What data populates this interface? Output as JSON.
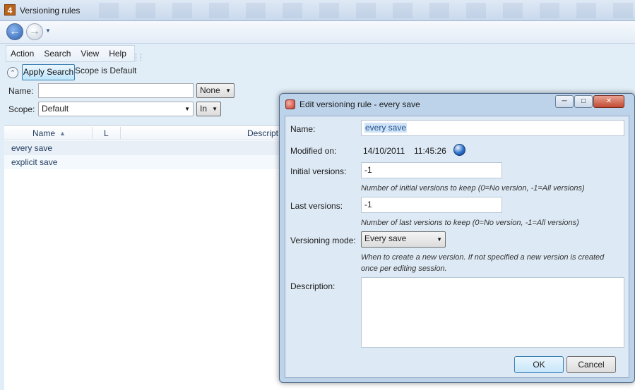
{
  "window": {
    "title": "Versioning rules",
    "app_icon_text": "4"
  },
  "menu": {
    "items": [
      "Action",
      "Search",
      "View",
      "Help"
    ]
  },
  "search": {
    "apply_label": "Apply Search",
    "scope_note": "Scope is Default",
    "name_label": "Name:",
    "name_value": "",
    "name_match": "None",
    "scope_label": "Scope:",
    "scope_value": "Default",
    "scope_match": "In"
  },
  "grid": {
    "columns": [
      "Name",
      "L",
      "Descript"
    ],
    "rows": [
      "every save",
      "explicit save"
    ]
  },
  "dialog": {
    "title": "Edit versioning rule - every save",
    "name_label": "Name:",
    "name_value": "every save",
    "modified_label": "Modified on:",
    "modified_date": "14/10/2011",
    "modified_time": "11:45:26",
    "initial_label": "Initial versions:",
    "initial_value": "-1",
    "initial_hint": "Number of initial versions to keep (0=No version, -1=All versions)",
    "last_label": "Last versions:",
    "last_value": "-1",
    "last_hint": "Number of last versions to keep (0=No version, -1=All versions)",
    "mode_label": "Versioning mode:",
    "mode_value": "Every save",
    "mode_hint_line1": "When to create a new version. If not specified a new version is created",
    "mode_hint_line2": "once per editing session.",
    "description_label": "Description:",
    "description_value": "",
    "ok_label": "OK",
    "cancel_label": "Cancel"
  }
}
